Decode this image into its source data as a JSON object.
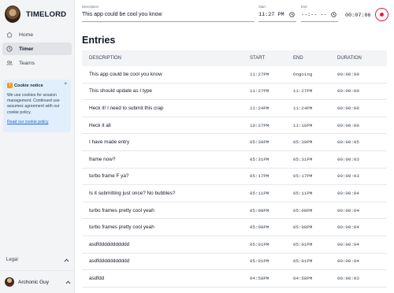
{
  "app": {
    "name": "TIMELORD"
  },
  "nav": [
    {
      "label": "Home",
      "icon": "home-icon",
      "active": false
    },
    {
      "label": "Timer",
      "icon": "clock-icon",
      "active": true
    },
    {
      "label": "Teams",
      "icon": "users-icon",
      "active": false
    }
  ],
  "cookie": {
    "title": "Cookie notice",
    "close": "×",
    "text": "We use cookies for session management. Continued use assumes agreement with our cookie policy.",
    "link": "Read our cookie policy"
  },
  "legal": {
    "label": "Legal"
  },
  "user": {
    "name": "Archonic Guy"
  },
  "timer": {
    "description_label": "Description",
    "description_value": "This app could be cool you know",
    "start_label": "Start",
    "start_value": "11:27 PM",
    "end_label": "End",
    "end_value": "--:-- --",
    "elapsed": "00:07:06",
    "accent_color": "#e11d48"
  },
  "page": {
    "title": "Entries"
  },
  "table": {
    "headers": [
      "DESCRIPTION",
      "START",
      "END",
      "DURATION"
    ],
    "rows": [
      [
        "This app could be cool you know",
        "11:27PM",
        "Ongoing",
        "00:00:00"
      ],
      [
        "This should update as I type",
        "11:27PM",
        "11:27PM",
        "00:00:00"
      ],
      [
        "Heck it! I need to submit this crap",
        "11:24PM",
        "11:24PM",
        "00:00:00"
      ],
      [
        "Heck it all",
        "10:27PM",
        "11:16PM",
        "00:00:00"
      ],
      [
        "I have made entry",
        "05:39PM",
        "05:39PM",
        "00:00:05"
      ],
      [
        "frame now?",
        "05:31PM",
        "05:31PM",
        "00:00:03"
      ],
      [
        "turbo frame F ya?",
        "05:17PM",
        "05:17PM",
        "00:00:03"
      ],
      [
        "Is it submitting just once? No bubbles?",
        "05:11PM",
        "05:11PM",
        "00:00:04"
      ],
      [
        "turbo frames pretty cool yeah",
        "05:08PM",
        "05:08PM",
        "00:00:04"
      ],
      [
        "turbo frames pretty cool yeah",
        "05:08PM",
        "05:08PM",
        "00:00:04"
      ],
      [
        "asdfddddddddddd",
        "05:01PM",
        "05:01PM",
        "00:00:04"
      ],
      [
        "asdfddddddddddd",
        "05:01PM",
        "05:01PM",
        "00:00:04"
      ],
      [
        "asdfdd",
        "04:58PM",
        "04:58PM",
        "00:00:03"
      ]
    ]
  }
}
